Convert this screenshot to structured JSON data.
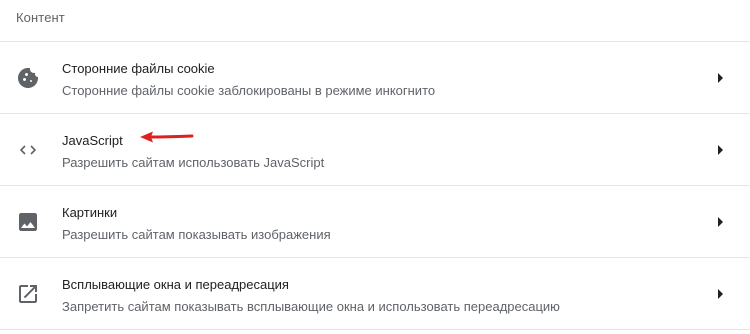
{
  "section": {
    "title": "Контент"
  },
  "rows": [
    {
      "icon": "cookie-icon",
      "title": "Сторонние файлы cookie",
      "subtitle": "Сторонние файлы cookie заблокированы в режиме инкогнито"
    },
    {
      "icon": "code-icon",
      "title": "JavaScript",
      "subtitle": "Разрешить сайтам использовать JavaScript"
    },
    {
      "icon": "image-icon",
      "title": "Картинки",
      "subtitle": "Разрешить сайтам показывать изображения"
    },
    {
      "icon": "open-in-new-icon",
      "title": "Всплывающие окна и переадресация",
      "subtitle": "Запретить сайтам показывать всплывающие окна и использовать переадресацию"
    }
  ],
  "colors": {
    "text_primary": "#202124",
    "text_secondary": "#5f6368",
    "divider": "#e6e6e6",
    "icon": "#5f6368",
    "annotation_arrow": "#e02020"
  }
}
